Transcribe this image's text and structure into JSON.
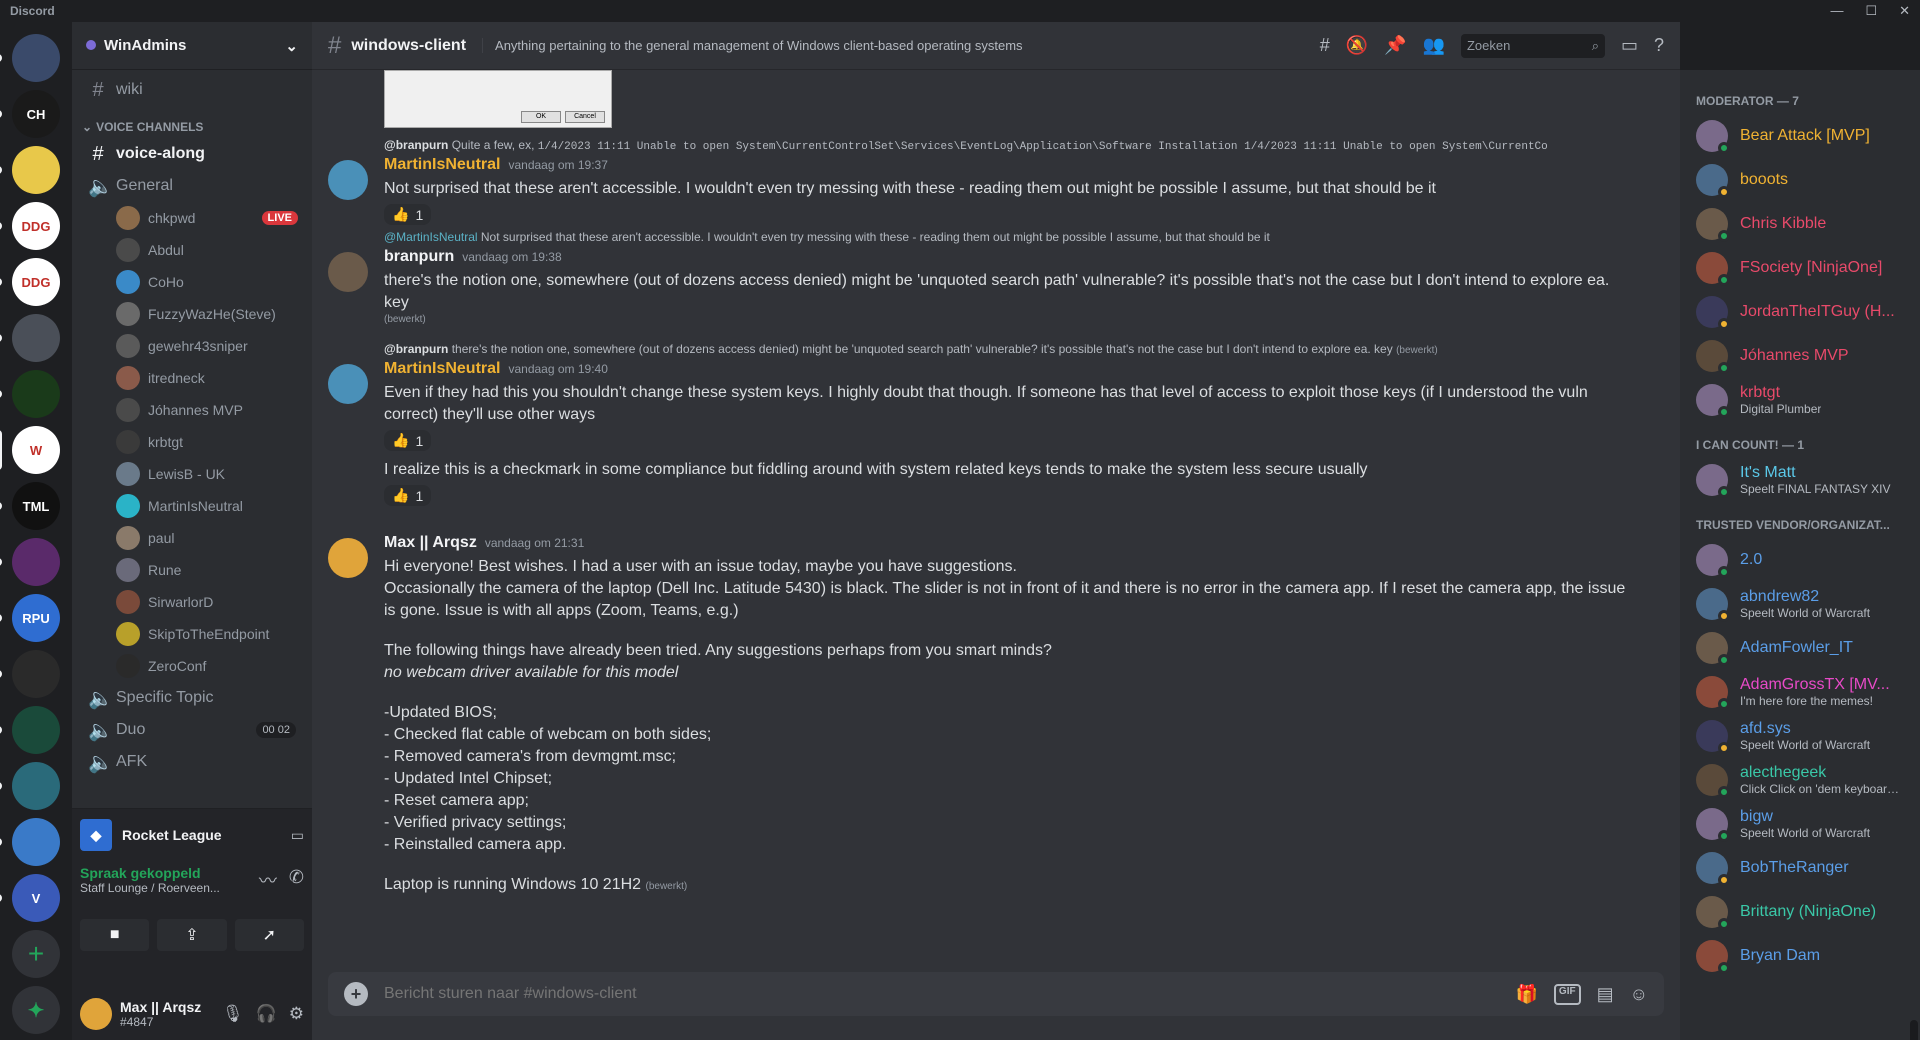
{
  "app_title": "Discord",
  "window_controls": [
    "—",
    "☐",
    "✕"
  ],
  "guilds": [
    {
      "label": "",
      "color": "#3a4a6a"
    },
    {
      "label": "CH",
      "color": "#1a1a1a"
    },
    {
      "label": "",
      "color": "#e8c84a"
    },
    {
      "label": "DDG",
      "color": "#ffffff"
    },
    {
      "label": "DDG",
      "color": "#ffffff"
    },
    {
      "label": "",
      "color": "#4a4f58"
    },
    {
      "label": "",
      "color": "#1a3a1a"
    },
    {
      "label": "W",
      "color": "#ffffff"
    },
    {
      "label": "TML",
      "color": "#111111"
    },
    {
      "label": "",
      "color": "#5a2a6a"
    },
    {
      "label": "RPU",
      "color": "#2f6dd1"
    },
    {
      "label": "",
      "color": "#2a2a2a"
    },
    {
      "label": "",
      "color": "#1a4a3a"
    },
    {
      "label": "",
      "color": "#2a6a7a"
    },
    {
      "label": "",
      "color": "#3a7ac8"
    },
    {
      "label": "V",
      "color": "#3a5ab8"
    }
  ],
  "server": {
    "name": "WinAdmins"
  },
  "channels": {
    "wiki": "wiki",
    "voice_category": "VOICE CHANNELS",
    "voice_along": "voice-along",
    "general": "General",
    "general_users": [
      "chkpwd",
      "Abdul",
      "CoHo",
      "FuzzyWazHe(Steve)",
      "gewehr43sniper",
      "itredneck",
      "Jóhannes MVP",
      "krbtgt",
      "LewisB - UK",
      "MartinIsNeutral",
      "paul",
      "Rune",
      "SirwarlorD",
      "SkipToTheEndpoint",
      "ZeroConf"
    ],
    "live_badge": "LIVE",
    "specific_topic": "Specific Topic",
    "duo": "Duo",
    "duo_count_a": "00",
    "duo_count_b": "02",
    "afk": "AFK"
  },
  "activity": {
    "game": "Rocket League",
    "voice_status": "Spraak gekoppeld",
    "voice_channel": "Staff Lounge / Roerveen..."
  },
  "user": {
    "name": "Max || Arqsz",
    "tag": "#4847"
  },
  "chat": {
    "channel": "windows-client",
    "topic": "Anything pertaining to the general management of Windows client-based operating systems",
    "search_placeholder": "Zoeken",
    "dialog_ok": "OK",
    "dialog_cancel": "Cancel",
    "composer_placeholder": "Bericht sturen naar #windows-client"
  },
  "messages": [
    {
      "reply_author": "@branpurn",
      "reply_text": "Quite a few, ex,",
      "reply_code": "1/4/2023 11:11    Unable to open System\\CurrentControlSet\\Services\\EventLog\\Application\\Software Installation 1/4/2023 11:11    Unable to open System\\CurrentCo",
      "author": "MartinIsNeutral",
      "time": "vandaag om 19:37",
      "text": "Not surprised that these aren't accessible. I wouldn't even try messing with these - reading them out might be possible I assume, but that should be it",
      "reaction": "1"
    },
    {
      "reply_author": "@MartinIsNeutral",
      "reply_text": "Not surprised that these aren't accessible. I wouldn't even try messing with these - reading them out might be possible I assume, but that should be it",
      "author": "branpurn",
      "time": "vandaag om 19:38",
      "text": "there's the notion one, somewhere (out of dozens access denied) might be 'unquoted search path' vulnerable? it's possible that's not the case but I don't intend to explore ea. key",
      "edited": "(bewerkt)"
    },
    {
      "reply_author": "@branpurn",
      "reply_text": "there's the notion one, somewhere (out of dozens access denied) might be 'unquoted search path' vulnerable? it's possible that's not the case but I don't intend to explore ea. key",
      "reply_edited": "(bewerkt)",
      "author": "MartinIsNeutral",
      "time": "vandaag om 19:40",
      "text": "Even if they had this you shouldn't change these system keys. I highly doubt that though. If someone has that level of access to exploit those keys (if I understood the vuln correct) they'll use other ways",
      "reaction": "1",
      "text2": "I realize this is a checkmark in some compliance but fiddling around with system related keys tends to make the system less secure usually",
      "reaction2": "1"
    },
    {
      "author": "Max || Arqsz",
      "time": "vandaag om 21:31",
      "lines": [
        "Hi everyone! Best wishes. I had a user with an issue today, maybe you have suggestions.",
        "Occasionally the camera of the laptop (Dell Inc. Latitude 5430) is black. The slider is not in front of it and there is no error in the camera app. If I reset the camera app, the issue is gone. Issue is with all apps (Zoom, Teams, e.g.)",
        "",
        "The following things have already been tried. Any suggestions perhaps from you smart minds?",
        "no webcam driver available for this model",
        "",
        " -Updated BIOS;",
        "- Checked flat cable of webcam on both sides;",
        "- Removed camera's from devmgmt.msc;",
        "- Updated Intel Chipset;",
        "- Reset camera app;",
        "- Verified privacy settings;",
        "- Reinstalled camera app.",
        "",
        "Laptop is running Windows 10 21H2"
      ],
      "edited": "(bewerkt)"
    }
  ],
  "members": {
    "cat_moderator": "MODERATOR — 7",
    "moderators": [
      {
        "name": "Bear Attack [MVP]",
        "color": "#f0b232",
        "sub": ""
      },
      {
        "name": "booots",
        "color": "#f0b232",
        "sub": ""
      },
      {
        "name": "Chris Kibble",
        "color": "#e84a6a",
        "sub": ""
      },
      {
        "name": "FSociety [NinjaOne]",
        "color": "#e84a6a",
        "sub": ""
      },
      {
        "name": "JordanTheITGuy (H...",
        "color": "#e84a6a",
        "sub": ""
      },
      {
        "name": "Jóhannes MVP",
        "color": "#e84a6a",
        "sub": ""
      },
      {
        "name": "krbtgt",
        "color": "#e84a6a",
        "sub": "Digital Plumber"
      }
    ],
    "cat_count": "I CAN COUNT! — 1",
    "counters": [
      {
        "name": "It's Matt",
        "color": "#5bc8e8",
        "sub": "Speelt FINAL FANTASY XIV"
      }
    ],
    "cat_vendor": "TRUSTED VENDOR/ORGANIZAT...",
    "vendors": [
      {
        "name": "2.0",
        "color": "#5b9ee8",
        "sub": ""
      },
      {
        "name": "abndrew82",
        "color": "#5b9ee8",
        "sub": "Speelt World of Warcraft"
      },
      {
        "name": "AdamFowler_IT",
        "color": "#5b9ee8",
        "sub": ""
      },
      {
        "name": "AdamGrossTX [MV...",
        "color": "#e84ac8",
        "sub": "I'm here fore the memes!"
      },
      {
        "name": "afd.sys",
        "color": "#5b9ee8",
        "sub": "Speelt World of Warcraft"
      },
      {
        "name": "alecthegeek",
        "color": "#3ac8a8",
        "sub": "Click Click on 'dem keyboards..."
      },
      {
        "name": "bigw",
        "color": "#5b9ee8",
        "sub": "Speelt World of Warcraft"
      },
      {
        "name": "BobTheRanger",
        "color": "#5b9ee8",
        "sub": ""
      },
      {
        "name": "Brittany (NinjaOne)",
        "color": "#3ac8a8",
        "sub": ""
      },
      {
        "name": "Bryan Dam",
        "color": "#5b9ee8",
        "sub": ""
      }
    ]
  }
}
